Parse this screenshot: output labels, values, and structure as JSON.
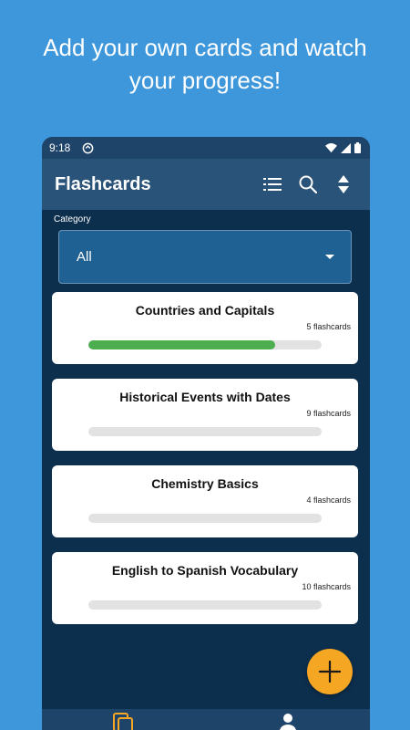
{
  "promo": {
    "line1": "Add your own cards and watch",
    "line2": "your progress!"
  },
  "status_bar": {
    "time": "9:18",
    "icons": [
      "sync-icon",
      "wifi-icon",
      "signal-icon",
      "battery-icon"
    ]
  },
  "app_bar": {
    "title": "Flashcards",
    "actions": [
      "list-icon",
      "search-icon",
      "sort-icon"
    ]
  },
  "category": {
    "label": "Category",
    "selected": "All"
  },
  "decks": [
    {
      "name": "Countries and Capitals",
      "count": "5 flashcards",
      "progress": 0.8
    },
    {
      "name": "Historical Events with Dates",
      "count": "9 flashcards",
      "progress": 0
    },
    {
      "name": "Chemistry Basics",
      "count": "4 flashcards",
      "progress": 0
    },
    {
      "name": "English to Spanish Vocabulary",
      "count": "10 flashcards",
      "progress": 0
    }
  ],
  "fab": {
    "icon": "plus-icon"
  },
  "bottom_nav": {
    "items": [
      "cards-icon",
      "profile-icon"
    ]
  },
  "colors": {
    "background": "#3d97da",
    "app_background": "#0d2f4e",
    "app_bar": "#2a5379",
    "dropdown": "#1f6193",
    "progress_fill": "#4cae4f",
    "progress_track": "#e2e2e2",
    "fab": "#f5a623",
    "nav_icon_active": "#f5a623"
  }
}
